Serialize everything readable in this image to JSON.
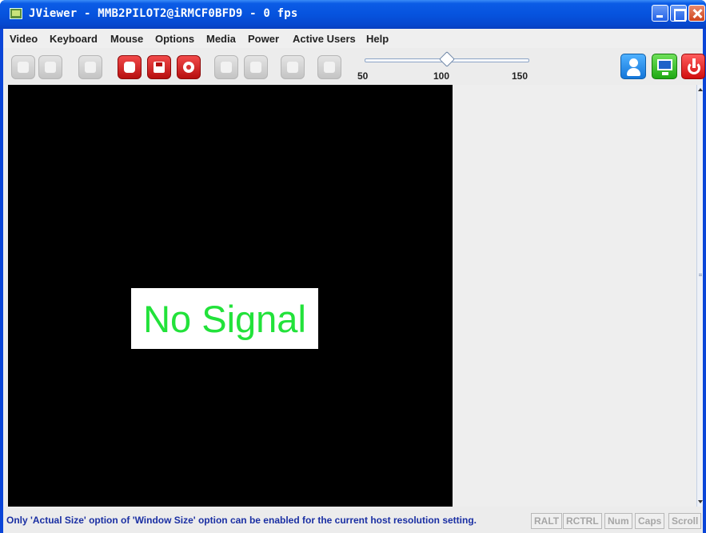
{
  "window": {
    "title": "JViewer - MMB2PILOT2@iRMCF0BFD9 - 0 fps"
  },
  "menu": {
    "items": [
      "Video",
      "Keyboard",
      "Mouse",
      "Options",
      "Media",
      "Power",
      "Active Users",
      "Help"
    ]
  },
  "toolbar": {
    "zoom": {
      "ticks": [
        "50",
        "100",
        "150"
      ],
      "value": 100,
      "min": 50,
      "max": 150
    }
  },
  "video": {
    "message": "No Signal"
  },
  "status": {
    "message": "Only 'Actual Size' option of 'Window Size' option can be enabled for the current host resolution setting.",
    "keys": [
      "RALT",
      "RCTRL",
      "Num",
      "Caps",
      "Scroll"
    ]
  },
  "colors": {
    "title_bar": "#0653de",
    "no_signal_text": "#22e23a",
    "status_text": "#1a2fa3"
  }
}
